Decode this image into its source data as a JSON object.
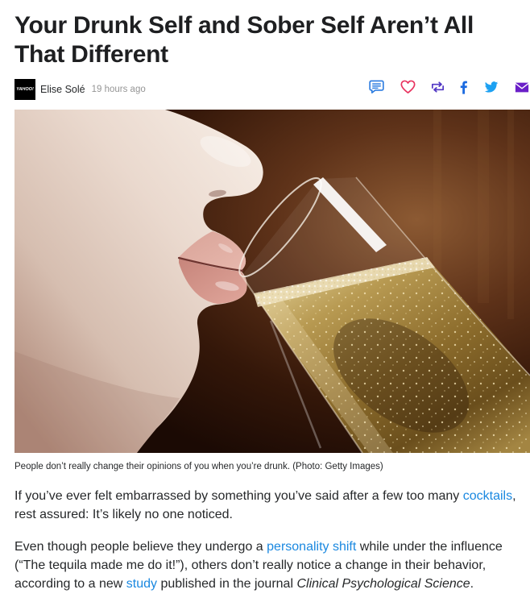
{
  "article": {
    "title": "Your Drunk Self and Sober Self Aren’t All That Different",
    "byline": {
      "logo_text": "YAHOO!",
      "author": "Elise Solé",
      "time": "19 hours ago"
    },
    "share_buttons": [
      {
        "icon": "comment-icon",
        "color": "#2a7be0"
      },
      {
        "icon": "heart-icon",
        "color": "#e8335f"
      },
      {
        "icon": "retweet-icon",
        "color": "#5238c4"
      },
      {
        "icon": "facebook-icon",
        "color": "#1b6ae0"
      },
      {
        "icon": "twitter-icon",
        "color": "#1da1f2"
      },
      {
        "icon": "mail-icon",
        "color": "#6a1fc8"
      }
    ],
    "hero_image": {
      "caption": "People don’t really change their opinions of you when you’re drunk. (Photo: Getty Images)"
    },
    "paragraphs": [
      {
        "text_1": "If you’ve ever felt embarrassed by something you’ve said after a few too many ",
        "link_1": "cocktails",
        "text_2": ", rest assured: It’s likely no one noticed."
      },
      {
        "text_1": "Even though people believe they undergo a ",
        "link_1": "personality shift",
        "text_2": " while under the influence (“The tequila made me do it!”), others don’t really notice a change in their behavior, according to a new ",
        "link_2": "study",
        "text_3": " published in the journal ",
        "journal": "Clinical Psychological Science",
        "text_4": "."
      }
    ]
  },
  "theme": {
    "title_color": "#1e1f21",
    "text_color": "#26282a",
    "meta_color": "#959595",
    "link_color": "#1a88e0"
  }
}
